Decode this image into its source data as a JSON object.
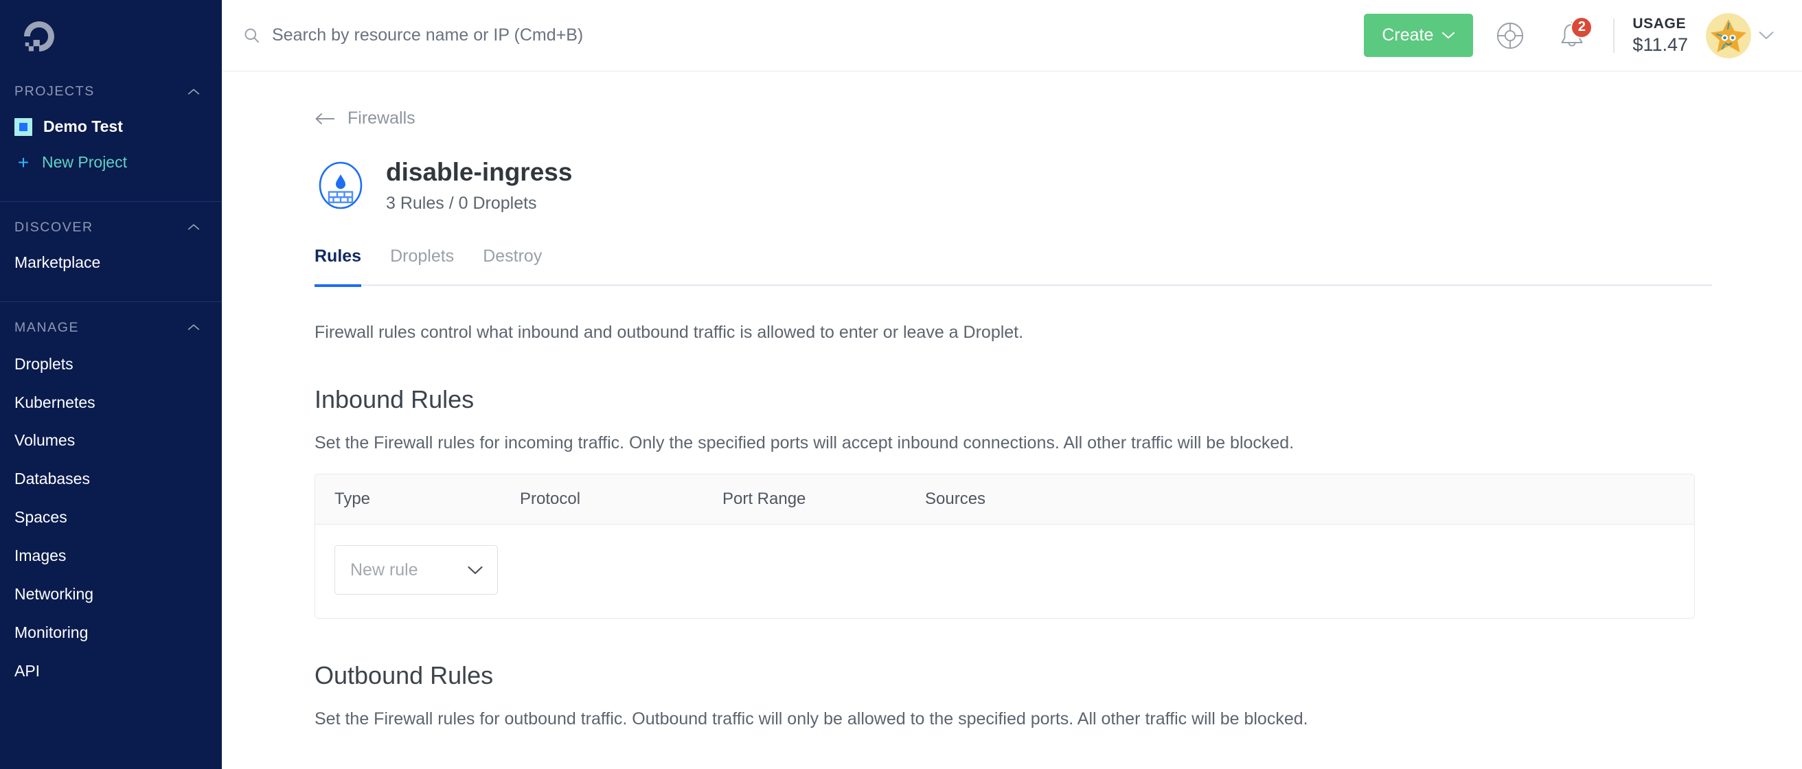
{
  "sidebar": {
    "logo_icon": "digitalocean-logo",
    "projects": {
      "label": "PROJECTS",
      "collapse_icon": "chevron-up-icon",
      "items": [
        {
          "label": "Demo Test",
          "icon": "project-swatch-icon"
        }
      ],
      "new_project": {
        "label": "New Project",
        "icon": "plus-icon"
      }
    },
    "discover": {
      "label": "DISCOVER",
      "collapse_icon": "chevron-up-icon",
      "items": [
        {
          "label": "Marketplace"
        }
      ]
    },
    "manage": {
      "label": "MANAGE",
      "collapse_icon": "chevron-up-icon",
      "items": [
        {
          "label": "Droplets"
        },
        {
          "label": "Kubernetes"
        },
        {
          "label": "Volumes"
        },
        {
          "label": "Databases"
        },
        {
          "label": "Spaces"
        },
        {
          "label": "Images"
        },
        {
          "label": "Networking"
        },
        {
          "label": "Monitoring"
        },
        {
          "label": "API"
        }
      ]
    }
  },
  "topbar": {
    "search": {
      "icon": "search-icon",
      "placeholder": "Search by resource name or IP (Cmd+B)",
      "value": ""
    },
    "create_button": {
      "label": "Create",
      "icon": "chevron-down-icon",
      "color": "#5bc97f"
    },
    "help_icon": "life-ring-icon",
    "notifications": {
      "icon": "bell-icon",
      "badge_count": "2",
      "badge_color": "#d94a38"
    },
    "usage": {
      "label": "USAGE",
      "amount": "$11.47"
    },
    "avatar": {
      "icon": "starfish-avatar",
      "menu_icon": "chevron-down-icon"
    }
  },
  "content": {
    "breadcrumb": {
      "back_icon": "arrow-left-icon",
      "label": "Firewalls"
    },
    "header": {
      "icon": "firewall-icon",
      "title": "disable-ingress",
      "subtitle": "3 Rules / 0 Droplets"
    },
    "tabs": [
      {
        "label": "Rules",
        "active": true
      },
      {
        "label": "Droplets",
        "active": false
      },
      {
        "label": "Destroy",
        "active": false
      }
    ],
    "active_tab_color": "#1d6ef3",
    "intro": "Firewall rules control what inbound and outbound traffic is allowed to enter or leave a Droplet.",
    "inbound": {
      "title": "Inbound Rules",
      "description": "Set the Firewall rules for incoming traffic. Only the specified ports will accept inbound connections. All other traffic will be blocked.",
      "columns": [
        "Type",
        "Protocol",
        "Port Range",
        "Sources"
      ],
      "rows": [],
      "new_rule": {
        "label": "New rule",
        "icon": "chevron-down-icon"
      }
    },
    "outbound": {
      "title": "Outbound Rules",
      "description": "Set the Firewall rules for outbound traffic. Outbound traffic will only be allowed to the specified ports. All other traffic will be blocked."
    }
  }
}
